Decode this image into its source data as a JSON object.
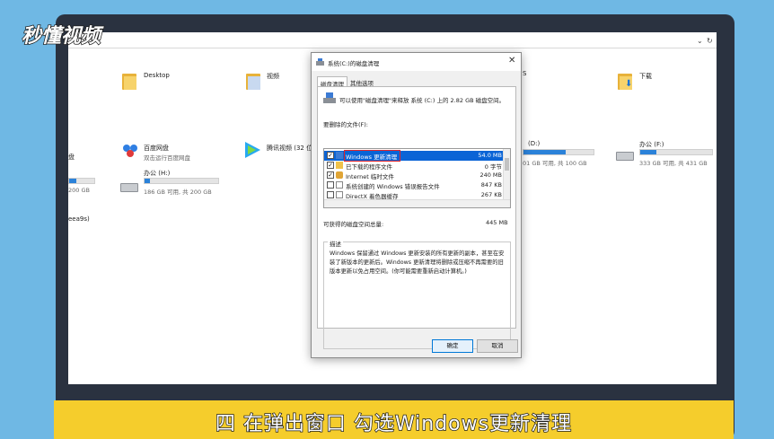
{
  "logo": "秒懂视频",
  "caption": "四 在弹出窗口 勾选Windows更新清理",
  "address_bar": {
    "dropdown_glyph": "⌄",
    "refresh_glyph": "↻"
  },
  "explorer": {
    "folders": [
      {
        "name": "Desktop"
      },
      {
        "name": "视频"
      },
      {
        "name": "下载"
      }
    ],
    "apps": [
      {
        "name": "百度网盘",
        "subtitle": "双击运行百度网盘"
      },
      {
        "name": "腾讯视频 (32 位"
      }
    ],
    "drives": [
      {
        "name": "办公 (H:)",
        "info": "186 GB 可用, 共 200 GB",
        "used_fraction": 0.07
      },
      {
        "name": "(D:)",
        "info": "01 GB 可用, 共 100 GB",
        "used_fraction": 0.6
      },
      {
        "name": "办公 (F:)",
        "info": "333 GB 可用, 共 431 GB",
        "used_fraction": 0.23
      }
    ],
    "left_fragments": {
      "drive_label": "盘",
      "drive_info": "200 GB",
      "network": "eea9s)"
    }
  },
  "dialog": {
    "title": "系统(C:)的磁盘清理",
    "close_glyph": "✕",
    "tabs": [
      "磁盘清理",
      "其他选项"
    ],
    "intro": "可以使用\"磁盘清理\"来释放 系统 (C:) 上的 2.82 GB 磁盘空间。",
    "files_label": "要删除的文件(F):",
    "files": [
      {
        "name": "Windows 更新清理",
        "size": "54.0 MB",
        "checked": true,
        "selected": true
      },
      {
        "name": "已下载的程序文件",
        "size": "0 字节",
        "checked": true,
        "selected": false
      },
      {
        "name": "Internet 临时文件",
        "size": "240 MB",
        "checked": true,
        "selected": false
      },
      {
        "name": "系统创建的 Windows 错误报告文件",
        "size": "847 KB",
        "checked": false,
        "selected": false
      },
      {
        "name": "DirectX 着色器缓存",
        "size": "267 KB",
        "checked": false,
        "selected": false
      }
    ],
    "space_label": "可获得的磁盘空间总量:",
    "space_value": "445 MB",
    "description_caption": "描述",
    "description": "Windows 保留通过 Windows 更新安装的所有更新的副本，甚至在安装了新版本的更新后。Windows 更新清理将删除或压缩不再需要的旧版本更新以免占用空间。(你可能需要重新启动计算机。)",
    "ok_label": "确定",
    "cancel_label": "取消",
    "check_glyph": "✓"
  },
  "colors": {
    "accent": "#0a64d6",
    "highlight": "#e0262b",
    "banner": "#f5cd2c",
    "background": "#6fb8e4"
  }
}
